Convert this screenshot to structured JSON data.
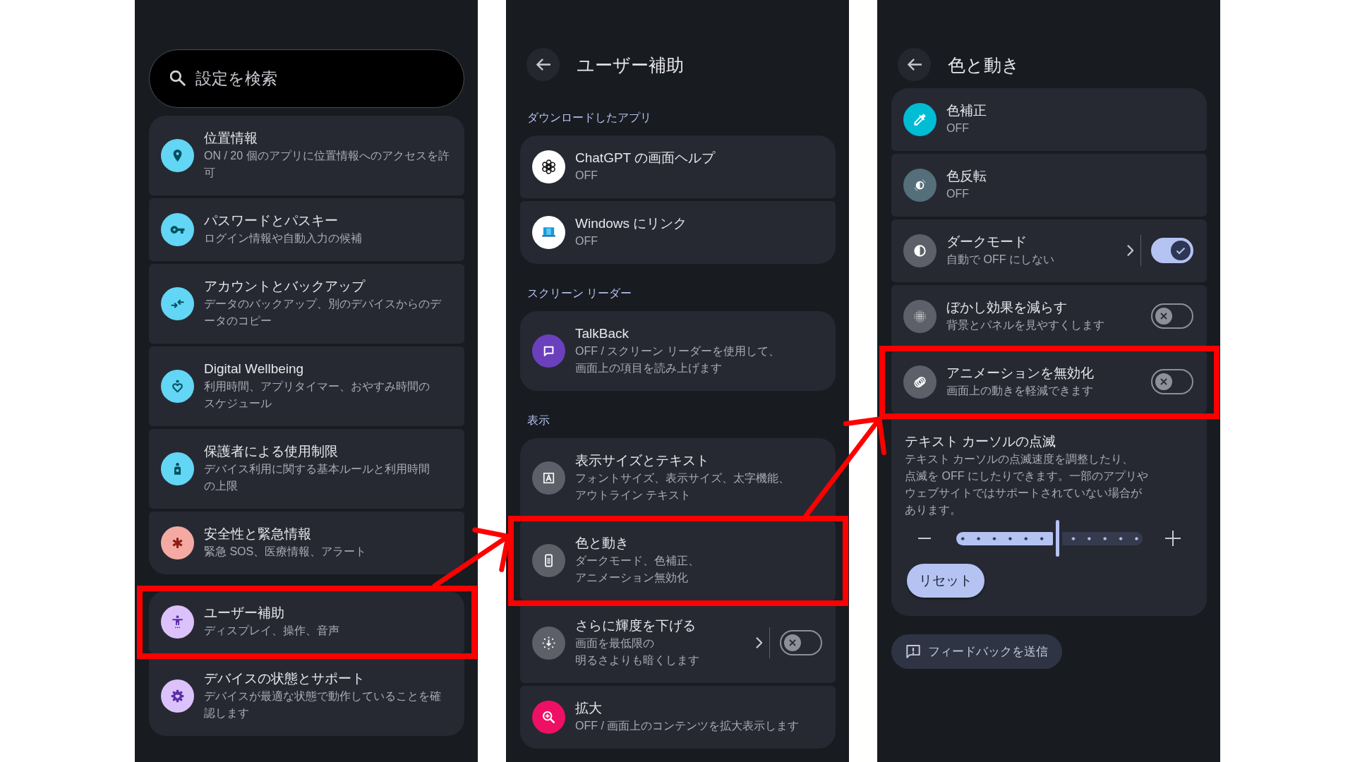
{
  "panels": [
    {
      "search": {
        "placeholder": "設定を検索"
      },
      "groups": [
        {
          "items": [
            {
              "kind": "nav",
              "title": "位置情報",
              "subtitle": "ON / 20 個のアプリに位置情報へのアクセスを許可"
            },
            {
              "kind": "nav",
              "title": "パスワードとパスキー",
              "subtitle": "ログイン情報や自動入力の候補"
            },
            {
              "kind": "nav",
              "title": "アカウントとバックアップ",
              "subtitle": "データのバックアップ、別のデバイスからのデータのコピー"
            },
            {
              "kind": "nav",
              "title": "Digital Wellbeing",
              "subtitle": "利用時間、アプリタイマー、おやすみ時間のスケジュール"
            },
            {
              "kind": "nav",
              "title": "保護者による使用制限",
              "subtitle": "デバイス利用に関する基本ルールと利用時間の上限"
            },
            {
              "kind": "nav",
              "title": "安全性と緊急情報",
              "subtitle": "緊急 SOS、医療情報、アラート"
            }
          ]
        },
        {
          "items": [
            {
              "kind": "nav",
              "title": "ユーザー補助",
              "subtitle": "ディスプレイ、操作、音声",
              "highlighted": true
            },
            {
              "kind": "nav",
              "title": "デバイスの状態とサポート",
              "subtitle": "デバイスが最適な状態で動作していることを確認します"
            }
          ]
        }
      ]
    },
    {
      "header": {
        "title": "ユーザー補助"
      },
      "groups": [
        {
          "heading": "ダウンロードしたアプリ",
          "items": [
            {
              "kind": "nav",
              "title": "ChatGPT の画面ヘルプ",
              "subtitle": "OFF"
            },
            {
              "kind": "nav",
              "title": "Windows にリンク",
              "subtitle": "OFF"
            }
          ]
        },
        {
          "heading": "スクリーン リーダー",
          "items": [
            {
              "kind": "nav",
              "title": "TalkBack",
              "subtitle": "OFF / スクリーン リーダーを使用して、画面上の項目を読み上げます"
            }
          ]
        },
        {
          "heading": "表示",
          "items": [
            {
              "kind": "nav",
              "title": "表示サイズとテキスト",
              "subtitle": "フォントサイズ、表示サイズ、太字機能、アウトライン テキスト"
            },
            {
              "kind": "nav",
              "title": "色と動き",
              "subtitle": "ダークモード、色補正、アニメーション無効化",
              "highlighted": true
            },
            {
              "kind": "split",
              "title": "さらに輝度を下げる",
              "subtitle": "画面を最低限の明るさよりも暗くします",
              "on": false
            },
            {
              "kind": "nav",
              "title": "拡大",
              "subtitle": "OFF / 画面上のコンテンツを拡大表示します"
            }
          ]
        }
      ]
    },
    {
      "header": {
        "title": "色と動き"
      },
      "groups": [
        {
          "items": [
            {
              "kind": "nav",
              "title": "色補正",
              "subtitle": "OFF"
            },
            {
              "kind": "nav",
              "title": "色反転",
              "subtitle": "OFF"
            },
            {
              "kind": "split",
              "title": "ダークモード",
              "subtitle": "自動で OFF にしない",
              "on": true
            },
            {
              "kind": "switch",
              "title": "ぼかし効果を減らす",
              "subtitle": "背景とパネルを見やすくします",
              "on": false
            },
            {
              "kind": "switch",
              "title": "アニメーションを無効化",
              "subtitle": "画面上の動きを軽減できます",
              "on": false,
              "highlighted": true
            },
            {
              "kind": "slider",
              "title": "テキスト カーソルの点滅",
              "subtitle": "テキスト カーソルの点滅速度を調整したり、点滅を OFF にしたりできます。一部のアプリやウェブサイトではサポートされていない場合があります。",
              "level": 0.544,
              "reset_button": "リセット"
            }
          ]
        }
      ],
      "feedback_button": "フィードバックを送信"
    }
  ]
}
